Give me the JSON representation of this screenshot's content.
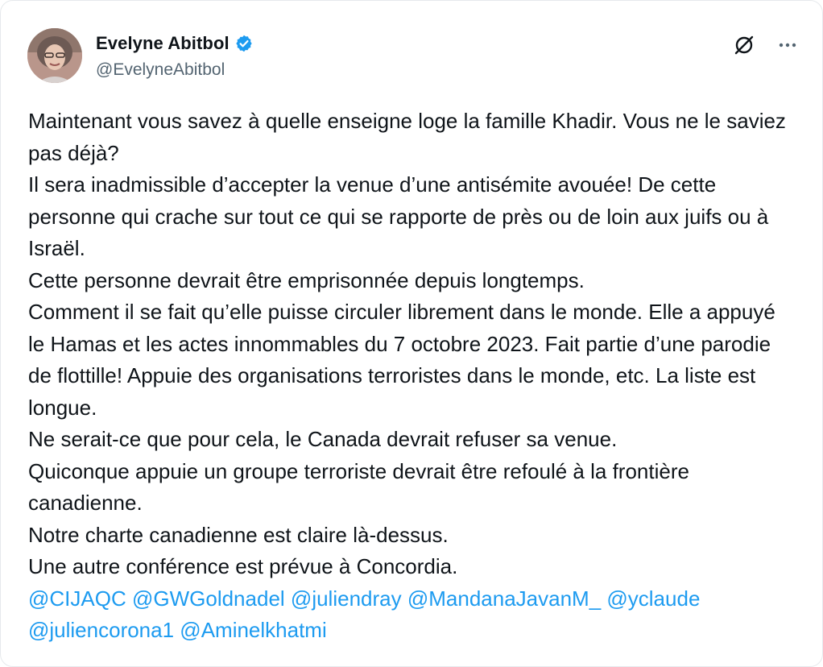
{
  "author": {
    "display_name": "Evelyne Abitbol",
    "handle": "@EvelyneAbitbol",
    "verified": true,
    "avatar_icon": "profile-photo"
  },
  "header_actions": {
    "grok_icon": "grok-slash-icon",
    "more_icon": "more-horizontal-icon"
  },
  "tweet": {
    "paragraphs": [
      "Maintenant vous savez à quelle enseigne loge la famille Khadir. Vous ne le saviez pas déjà?",
      "Il sera inadmissible d’accepter la venue d’une antisémite avouée! De cette personne qui crache sur tout ce qui se rapporte de près ou de loin aux juifs ou à Israël.",
      "Cette personne devrait être emprisonnée depuis longtemps.",
      "Comment il se fait qu’elle puisse circuler librement dans le monde. Elle a appuyé le Hamas et les actes innommables du 7 octobre 2023. Fait partie d’une parodie de flottille! Appuie des organisations terroristes dans le monde, etc. La liste est longue.",
      "Ne serait-ce que pour cela, le Canada devrait refuser sa venue.",
      "Quiconque appuie un groupe terroriste devrait être refoulé à la frontière canadienne.",
      "Notre charte canadienne est claire là-dessus.",
      "Une autre conférence est prévue à Concordia."
    ],
    "mentions": [
      "@CIJAQC",
      "@GWGoldnadel",
      "@juliendray",
      "@MandanaJavanM_",
      "@yclaude",
      "@juliencorona1",
      "@Aminelkhatmi"
    ]
  },
  "colors": {
    "text": "#0f1419",
    "secondary": "#536471",
    "link": "#1d9bf0",
    "verified": "#1d9bf0"
  }
}
